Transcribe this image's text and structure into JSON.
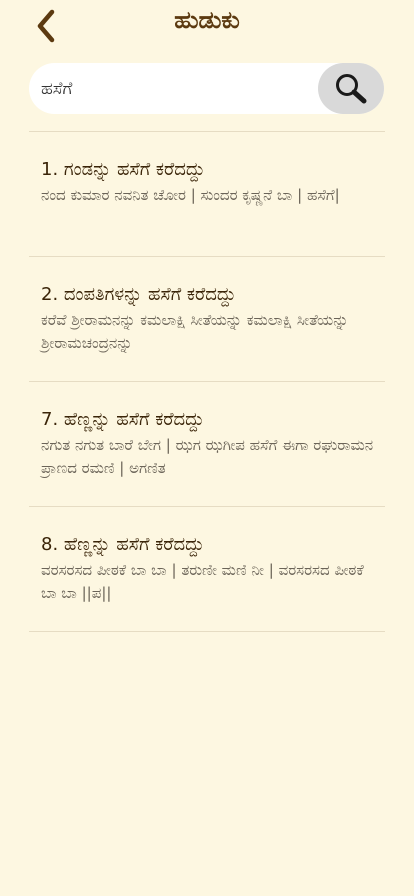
{
  "header": {
    "title": "ಹುಡುಕು",
    "back_icon": "chevron-left-icon"
  },
  "search": {
    "value": "ಹಸೆಗೆ",
    "placeholder": "",
    "button_icon": "search-icon"
  },
  "results": [
    {
      "title": "1. ಗಂಡನ್ನು ಹಸೆಗೆ ಕರೆದದ್ದು",
      "snippet": "ನಂದ ಕುಮಾರ ನವನಿತ ಚೋರ | ಸುಂದರ ಕೃಷ್ಣನೆ ಬಾ | ಹಸೆಗೆ|"
    },
    {
      "title": "2. ದಂಪತಿಗಳನ್ನು ಹಸೆಗೆ ಕರೆದದ್ದು",
      "snippet": "ಕರೆವೆ ಶ್ರೀರಾಮನನ್ನು ಕಮಲಾಕ್ಷಿ ಸೀತೆಯನ್ನು ಕಮಲಾಕ್ಷಿ ಸೀತೆಯನ್ನು ಶ್ರೀರಾಮಚಂದ್ರನನ್ನು"
    },
    {
      "title": "7. ಹೆಣ್ಣನ್ನು ಹಸೆಗೆ ಕರೆದದ್ದು",
      "snippet": "ನಗುತ ನಗುತ ಬಾರೆ ಬೇಗ | ಝಗ ಝಗೀಪ ಹಸೆಗೆ ಈಗಾ ರಘುರಾಮನ ಪ್ರಾಣದ ರಮಣಿ | ಅಗಣಿತ"
    },
    {
      "title": "8. ಹೆಣ್ಣನ್ನು ಹಸೆಗೆ ಕರೆದದ್ದು",
      "snippet": "ವರಸರಸದ ಪೀಠಕೆ ಬಾ ಬಾ | ತರುಣೀ ಮಣಿ ನೀ | ವರಸರಸದ ಪೀಠಕೆ ಬಾ ಬಾ ||ಪ||"
    }
  ],
  "colors": {
    "background": "#fdf7e1",
    "title": "#5c3a10",
    "search_button": "#d9d9d9",
    "divider": "#e6dcc3"
  }
}
